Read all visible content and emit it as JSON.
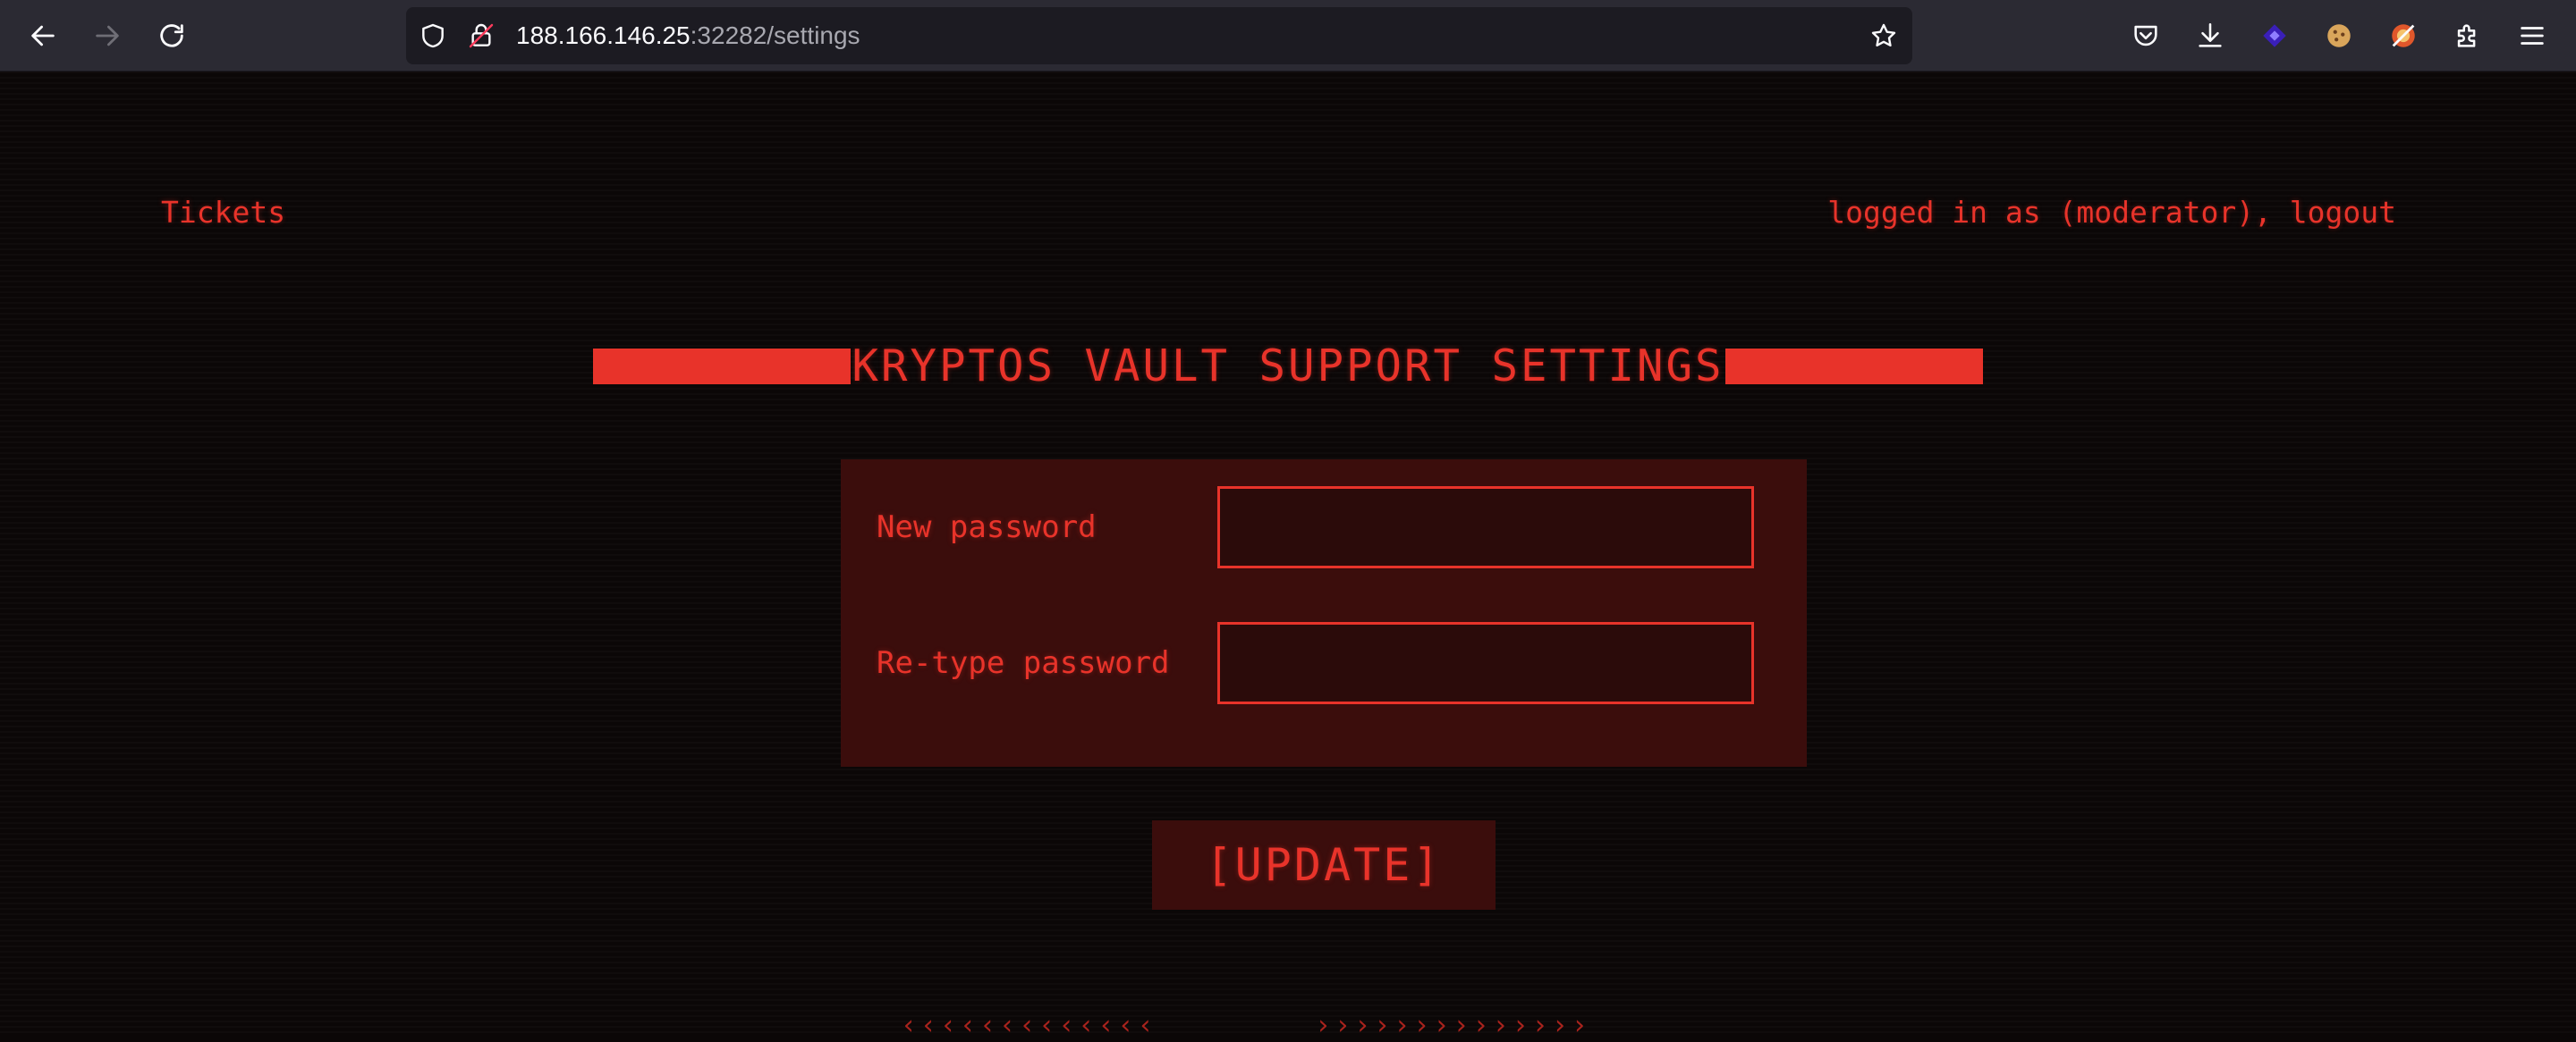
{
  "browser": {
    "url_host": "188.166.146.25",
    "url_rest": ":32282/settings",
    "icons": [
      "back-icon",
      "forward-icon",
      "reload-icon",
      "shield-icon",
      "insecure-lock-icon",
      "bookmark-star-icon",
      "pocket-icon",
      "download-icon",
      "extension-purple-icon",
      "cookie-icon",
      "extension-orange-icon",
      "extensions-puzzle-icon",
      "menu-icon"
    ]
  },
  "nav": {
    "tickets_link": "Tickets",
    "session_text": "logged in as (moderator), logout"
  },
  "header": {
    "title": "KRYPTOS VAULT SUPPORT SETTINGS"
  },
  "form": {
    "new_password_label": "New password",
    "new_password_value": "",
    "retype_password_label": "Re-type password",
    "retype_password_value": ""
  },
  "actions": {
    "update_label": "[UPDATE]"
  },
  "decoration": {
    "left_arrows": "‹‹‹‹‹‹‹‹‹‹‹‹‹",
    "right_arrows": "››››››››››››››"
  },
  "colors": {
    "accent": "#e8332a",
    "background": "#0b0707",
    "panel": "#3b0d0c"
  }
}
